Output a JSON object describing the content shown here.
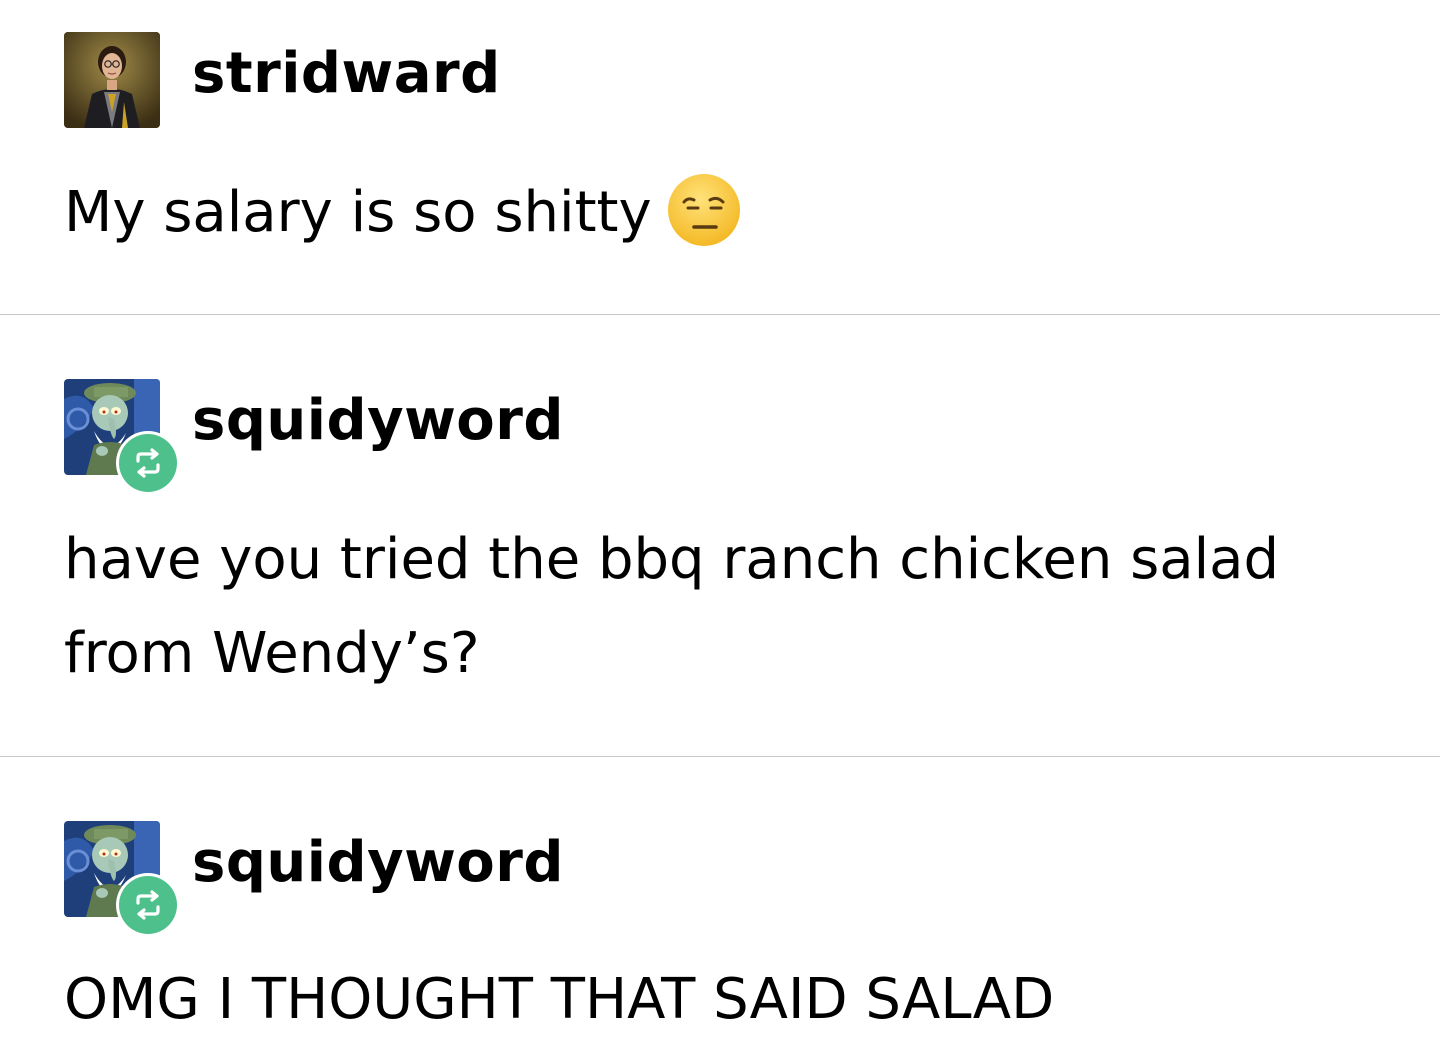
{
  "posts": [
    {
      "username": "stridward",
      "avatar_icon": "wizard-student-avatar",
      "text": "My salary is so shitty",
      "emoji": "unamused-face-emoji",
      "reblogged": false
    },
    {
      "username": "squidyword",
      "avatar_icon": "squidward-avatar",
      "text": "have you tried the bbq ranch chicken salad\nfrom Wendy’s?",
      "reblogged": true,
      "reblog_icon": "reblog-icon"
    },
    {
      "username": "squidyword",
      "avatar_icon": "squidward-avatar",
      "text": "OMG I THOUGHT THAT SAID SALAD",
      "reblogged": true,
      "reblog_icon": "reblog-icon"
    }
  ],
  "colors": {
    "reblog_badge": "#4ec08b",
    "divider": "#c8c8c8",
    "text": "#000000",
    "background": "#ffffff"
  }
}
